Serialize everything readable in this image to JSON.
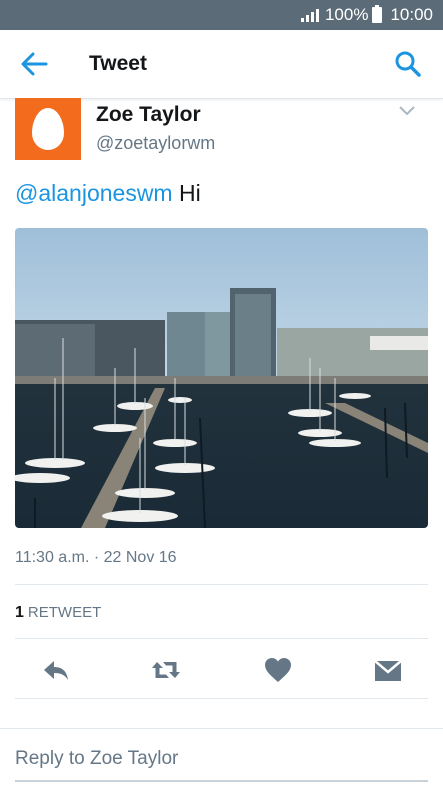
{
  "status_bar": {
    "battery": "100%",
    "time": "10:00"
  },
  "app_bar": {
    "title": "Tweet",
    "back_icon": "arrow-left-icon",
    "search_icon": "search-icon"
  },
  "tweet": {
    "author_name": "Zoe Taylor",
    "author_handle": "@zoetaylorwm",
    "mention": "@alanjoneswm",
    "text": " Hi",
    "timestamp": "11:30 a.m. · 22 Nov 16",
    "retweet_count": "1",
    "retweet_label": "RETWEET",
    "photo_subject": "marina-with-sailboats-and-office-buildings"
  },
  "actions": [
    "reply-icon",
    "retweet-icon",
    "like-icon",
    "direct-message-icon"
  ],
  "reply": {
    "placeholder": "Reply to Zoe Taylor"
  },
  "colors": {
    "accent": "#1b95e0",
    "avatar": "#f36b1c",
    "statusbar": "#5b6b78",
    "muted": "#657786"
  }
}
